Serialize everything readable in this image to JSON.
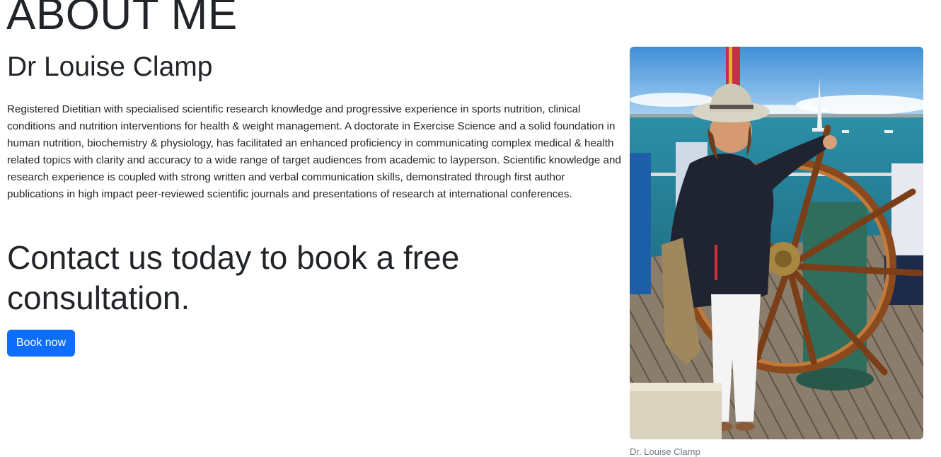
{
  "section": {
    "heading": "ABOUT ME",
    "name": "Dr Louise Clamp",
    "bio": "Registered Dietitian with specialised scientific research knowledge and progressive experience in sports nutrition, clinical conditions and nutrition interventions for health & weight management. A doctorate in Exercise Science and a solid foundation in human nutrition, biochemistry & physiology, has facilitated an enhanced proficiency in communicating complex medical & health related topics with clarity and accuracy to a wide range of target audiences from academic to layperson. Scientific knowledge and research experience is coupled with strong written and verbal communication skills, demonstrated through first author publications in high impact peer-reviewed scientific journals and presentations of research at international conferences.",
    "cta_heading": "Contact us today to book a free consultation.",
    "button_label": "Book now",
    "button_color": "#0d6efd"
  },
  "photo": {
    "caption": "Dr. Louise Clamp"
  }
}
